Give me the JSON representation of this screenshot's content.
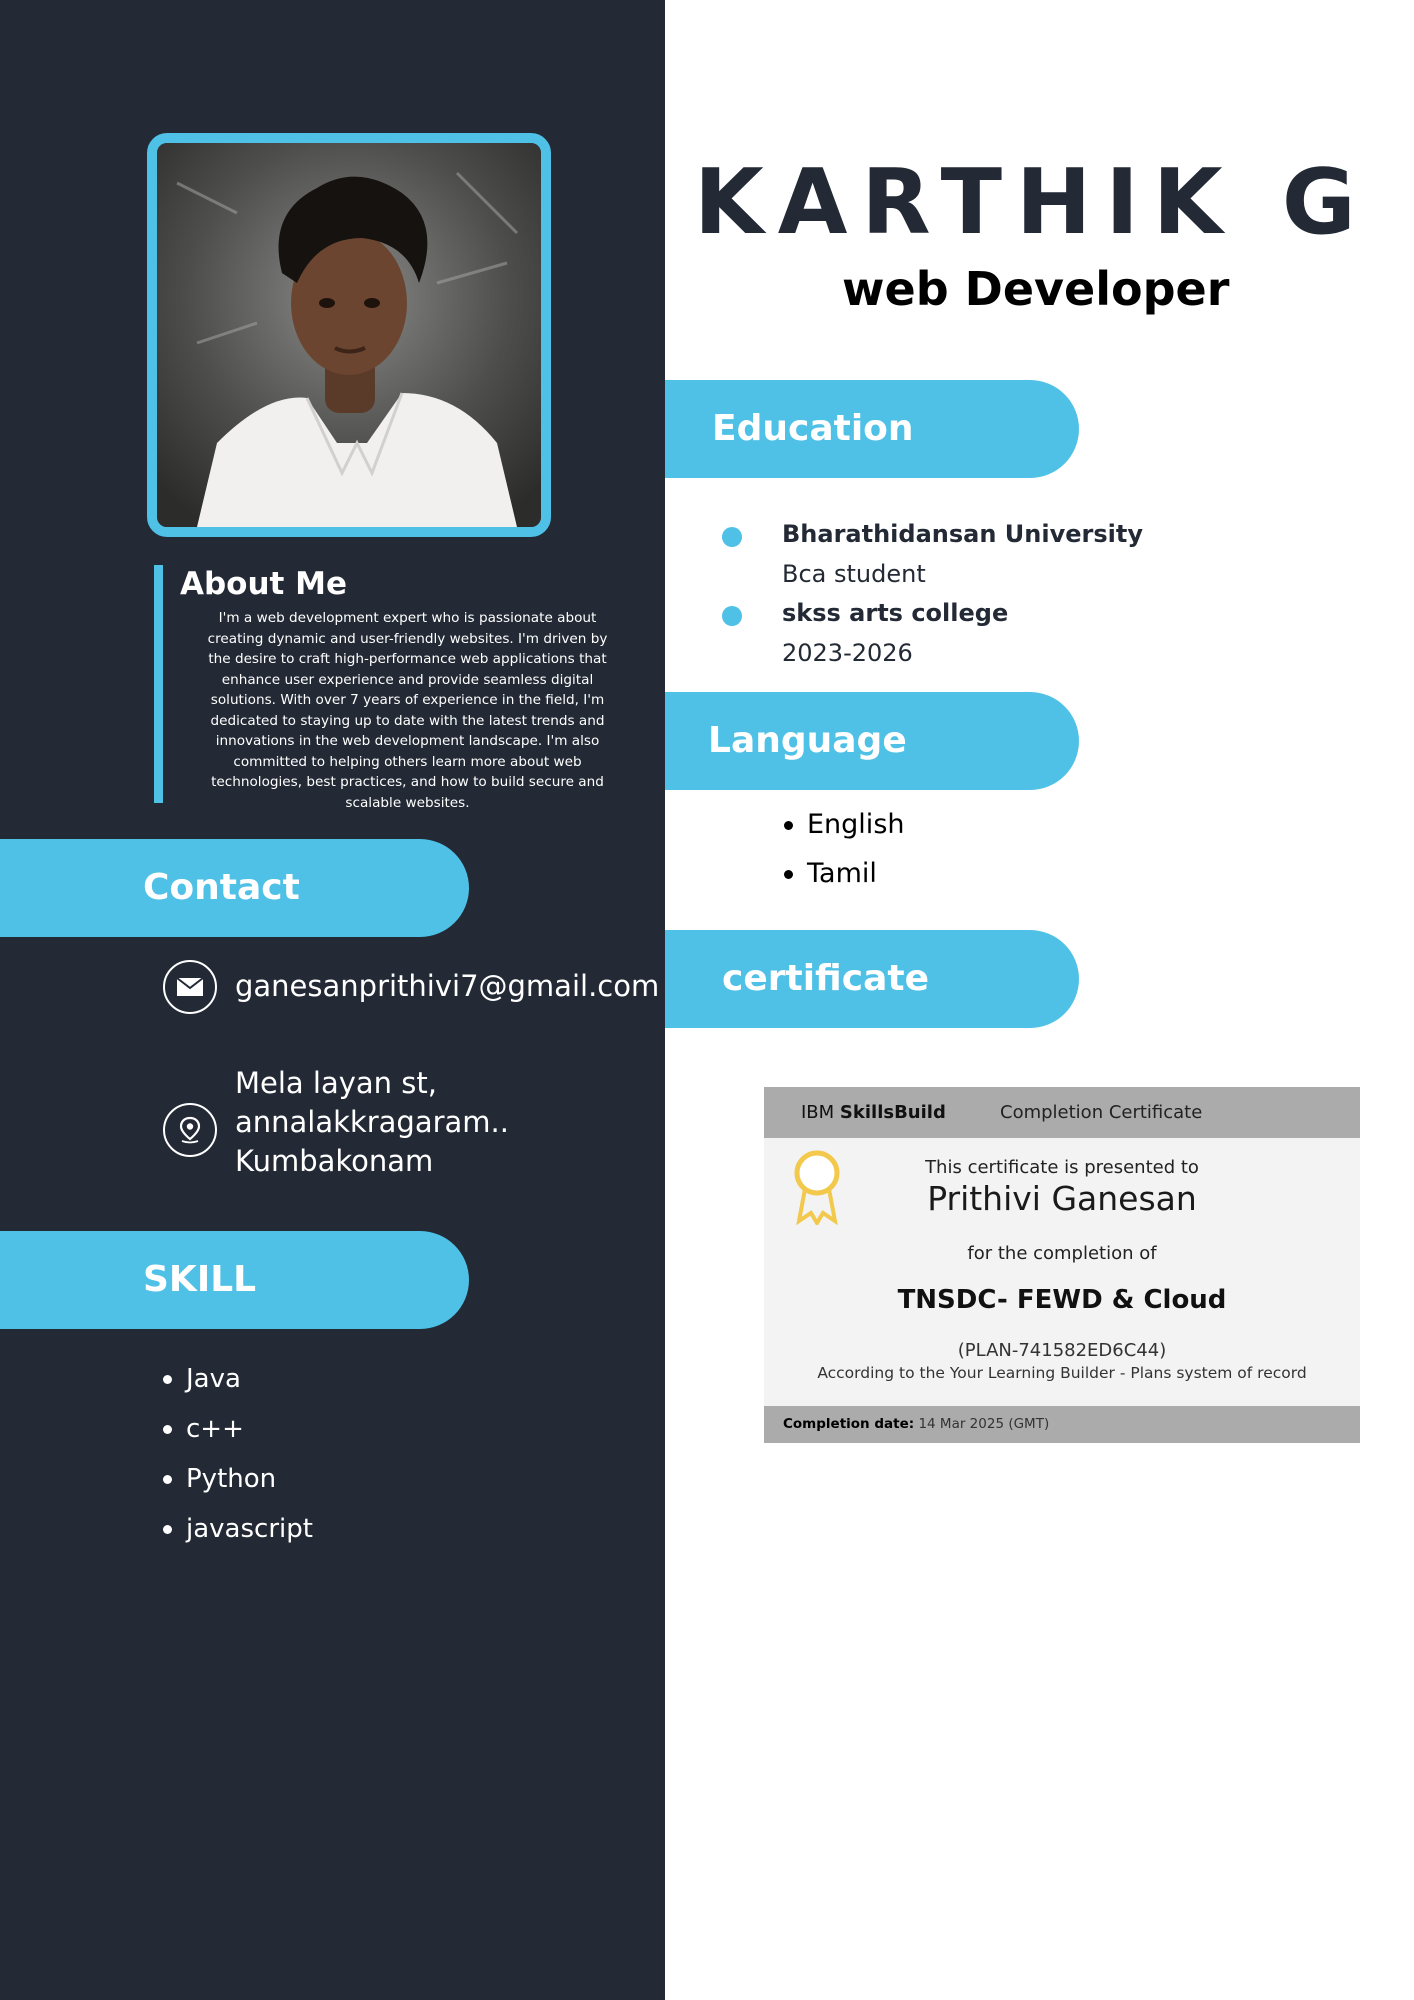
{
  "header": {
    "name": "KARTHIK G",
    "role": "web Developer"
  },
  "about": {
    "title": "About Me",
    "text": "I'm a web development expert who is passionate about creating dynamic and user-friendly websites. I'm driven by the desire to craft high-performance web applications that enhance user experience and provide seamless digital solutions. With over 7 years of experience in the field, I'm dedicated to staying up to date with the latest trends and innovations in the web development landscape. I'm also committed to helping others learn more about web technologies, best practices, and how to build secure and scalable websites."
  },
  "contact": {
    "title": "Contact",
    "email": "ganesanprithivi7@gmail.com",
    "address": {
      "line1": "Mela layan st,",
      "line2": "annalakkragaram..",
      "line3": "Kumbakonam"
    }
  },
  "skills": {
    "title": "SKILL",
    "items": [
      "Java",
      "c++",
      "Python",
      "javascript"
    ]
  },
  "education": {
    "title": "Education",
    "items": [
      {
        "title": "Bharathidansan University",
        "sub": "Bca student"
      },
      {
        "title": "skss arts college",
        "sub": "2023-2026"
      }
    ]
  },
  "language": {
    "title": "Language",
    "items": [
      "English",
      "Tamil"
    ]
  },
  "certificate": {
    "title": "certificate",
    "brand_prefix": "IBM",
    "brand_name": "SkillsBuild",
    "kind": "Completion Certificate",
    "presented_to": "This certificate is presented to",
    "recipient": "Prithivi Ganesan",
    "for_completion": "for the completion of",
    "course": "TNSDC- FEWD & Cloud",
    "plan": "(PLAN-741582ED6C44)",
    "according": "According to the Your Learning Builder - Plans system of record",
    "date_label": "Completion date:",
    "date_value": "14 Mar 2025 (GMT)"
  },
  "colors": {
    "sidebar": "#232a35",
    "accent": "#4fc0e6",
    "ribbon": "#f2c94c"
  },
  "icons": {
    "contact_email": "envelope-icon",
    "contact_address": "location-pin-icon",
    "certificate_badge": "award-ribbon-icon"
  }
}
